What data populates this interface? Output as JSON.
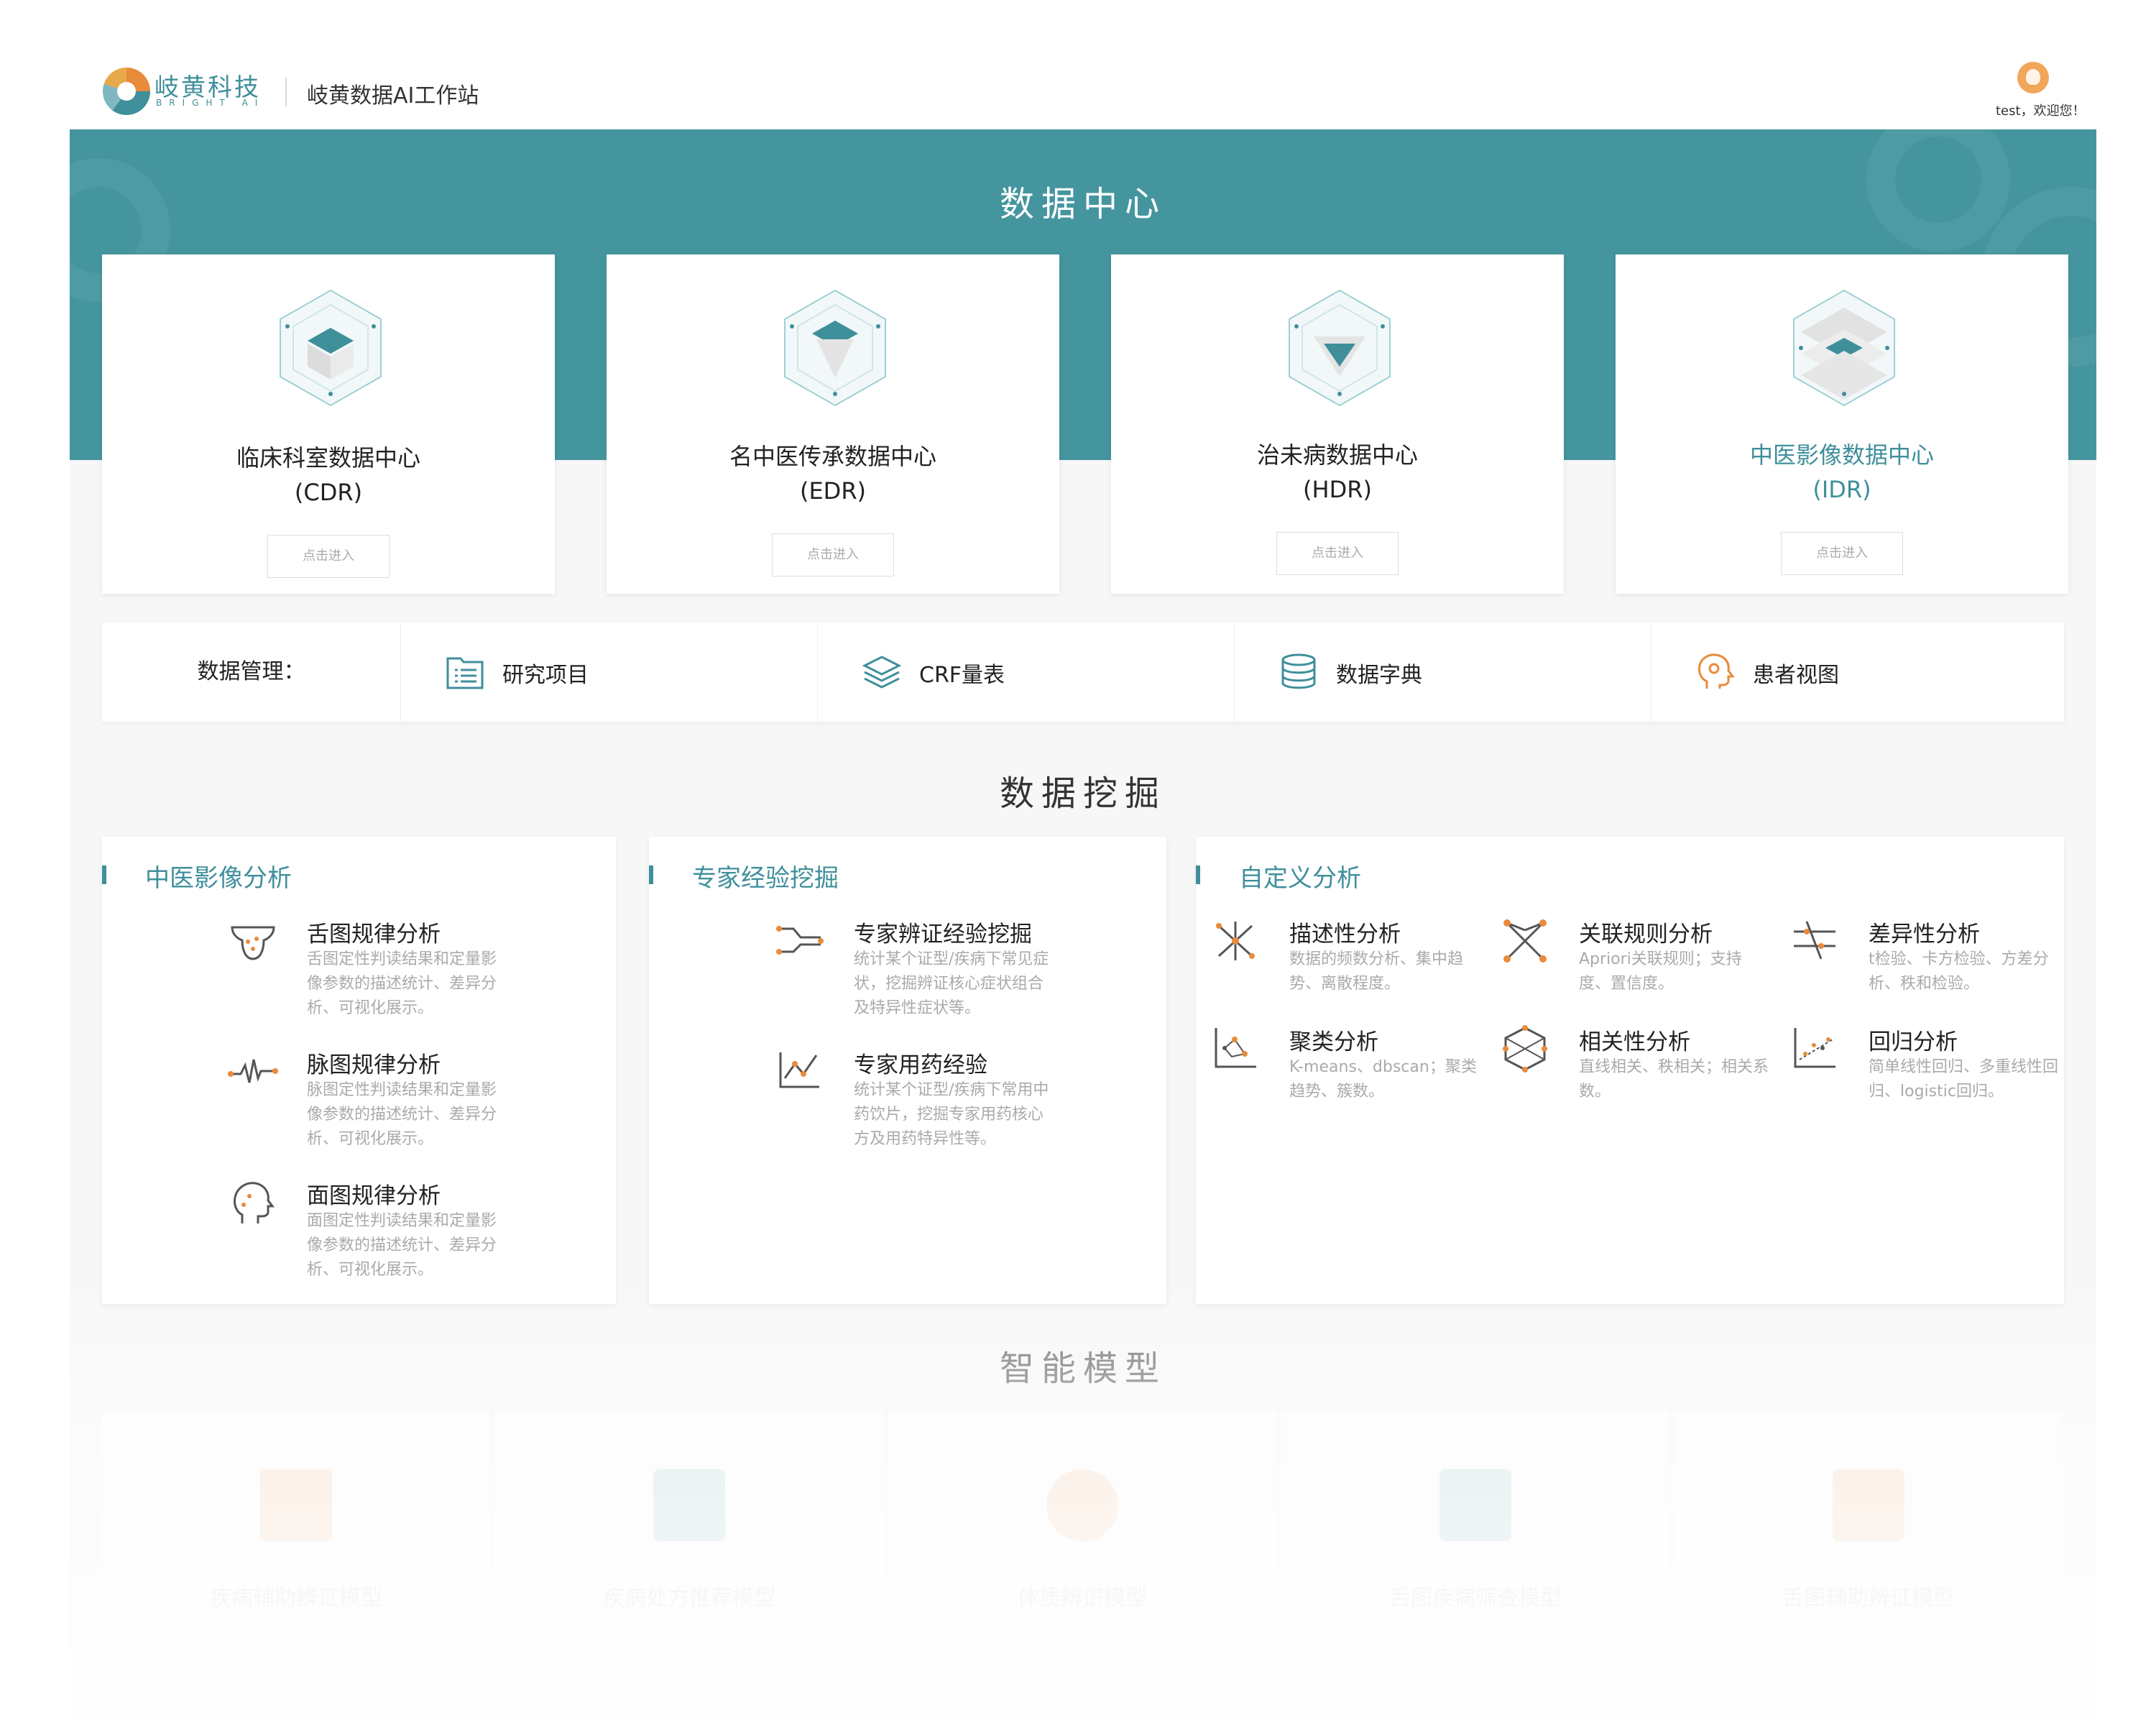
{
  "header": {
    "brand_cn": "岐黄科技",
    "brand_en": "BRIGHT AI",
    "app_title": "岐黄数据AI工作站",
    "welcome": "test，欢迎您！"
  },
  "data_center": {
    "title": "数据中心",
    "cards": [
      {
        "name": "临床科室数据中心",
        "code": "(CDR)",
        "button": "点击进入",
        "icon": "cube-icon"
      },
      {
        "name": "名中医传承数据中心",
        "code": "(EDR)",
        "button": "点击进入",
        "icon": "cube-icon"
      },
      {
        "name": "治未病数据中心",
        "code": "(HDR)",
        "button": "点击进入",
        "icon": "cube-icon"
      },
      {
        "name": "中医影像数据中心",
        "code": "(IDR)",
        "button": "点击进入",
        "icon": "layers-cube-icon"
      }
    ],
    "management": {
      "label": "数据管理：",
      "items": [
        {
          "label": "研究项目",
          "icon": "list-icon"
        },
        {
          "label": "CRF量表",
          "icon": "layers-icon"
        },
        {
          "label": "数据字典",
          "icon": "database-icon"
        },
        {
          "label": "患者视图",
          "icon": "head-profile-icon"
        }
      ]
    }
  },
  "data_mining": {
    "title": "数据挖掘",
    "panels": [
      {
        "title": "中医影像分析",
        "items": [
          {
            "name": "舌图规律分析",
            "desc": "舌图定性判读结果和定量影像参数的描述统计、差异分析、可视化展示。"
          },
          {
            "name": "脉图规律分析",
            "desc": "脉图定性判读结果和定量影像参数的描述统计、差异分析、可视化展示。"
          },
          {
            "name": "面图规律分析",
            "desc": "面图定性判读结果和定量影像参数的描述统计、差异分析、可视化展示。"
          }
        ]
      },
      {
        "title": "专家经验挖掘",
        "items": [
          {
            "name": "专家辨证经验挖掘",
            "desc": "统计某个证型/疾病下常见症状，挖掘辨证核心症状组合及特异性症状等。"
          },
          {
            "name": "专家用药经验",
            "desc": "统计某个证型/疾病下常用中药饮片，挖掘专家用药核心方及用药特异性等。"
          }
        ]
      },
      {
        "title": "自定义分析",
        "items": [
          {
            "name": "描述性分析",
            "desc": "数据的频数分析、集中趋势、离散程度。"
          },
          {
            "name": "关联规则分析",
            "desc": "Apriori关联规则；支持度、置信度。"
          },
          {
            "name": "差异性分析",
            "desc": "t检验、卡方检验、方差分析、秩和检验。"
          },
          {
            "name": "聚类分析",
            "desc": "K-means、dbscan；聚类趋势、簇数。"
          },
          {
            "name": "相关性分析",
            "desc": "直线相关、秩相关；相关系数。"
          },
          {
            "name": "回归分析",
            "desc": "简单线性回归、多重线性回归、logistic回归。"
          }
        ]
      }
    ]
  },
  "smart_models": {
    "title": "智能模型",
    "models": [
      {
        "name": "疾病辅助辨证模型",
        "color": "#e88b3a"
      },
      {
        "name": "疾病处方推荐模型",
        "color": "#3f8f9b"
      },
      {
        "name": "体质辨识模型",
        "color": "#e88b3a"
      },
      {
        "name": "舌图疾病筛查模型",
        "color": "#3f8f9b"
      },
      {
        "name": "舌图辅助辨证模型",
        "color": "#e88b3a"
      }
    ]
  },
  "colors": {
    "accent": "#45959f",
    "accent_text": "#3f8f9b",
    "orange": "#e88b3a"
  }
}
